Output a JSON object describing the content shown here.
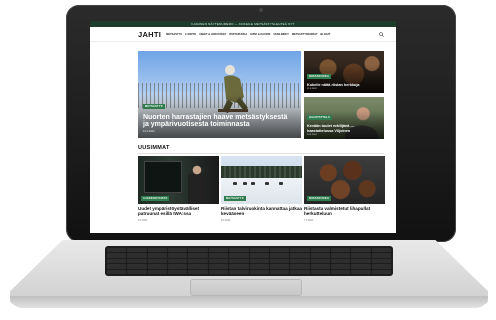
{
  "site": {
    "topbar_text": "ILMAINEN NÄYTENUMERO — KOKEILE METSÄSTYSLEHTEÄ NYT",
    "logo": "JAHTI",
    "nav": [
      "METSÄSTYS",
      "LUONTO",
      "ASEET & VARUSTEET",
      "RIISTARUOKA",
      "HIRVI & KAURIS",
      "VESILINNUT",
      "METSÄSTYSKOIRAT",
      "BLOGIT"
    ]
  },
  "hero": {
    "tag": "METSÄSTYS",
    "title": "Nuorten harrastajien haave metsästyksestä ja ympärivuotisesta toiminnasta",
    "date": "12.3.2024"
  },
  "side_articles": [
    {
      "tag": "RIISTARUOKA",
      "title": "Kokeile näitä riistan herkkuja",
      "date": "11.3.2024"
    },
    {
      "tag": "HAASTATTELU",
      "title": "Kevään tuulet eräilijänä — haastattelussa Viljoinen",
      "date": "10.3.2024"
    }
  ],
  "section": {
    "heading": "UUSIMMAT"
  },
  "cards": [
    {
      "tag": "AJANKOHTAISTA",
      "title": "Uudet ympäristöystävälliset patruunat esillä IWA:ssa",
      "date": "8.3.2024"
    },
    {
      "tag": "METSÄSTYS",
      "title": "Riistan talviruokinta kannattaa jatkaa kevääseen",
      "date": "8.3.2024"
    },
    {
      "tag": "RIISTARUOKA",
      "title": "Riistasta valmistetut lihapullat herkutteluun",
      "date": "7.3.2024"
    }
  ]
}
